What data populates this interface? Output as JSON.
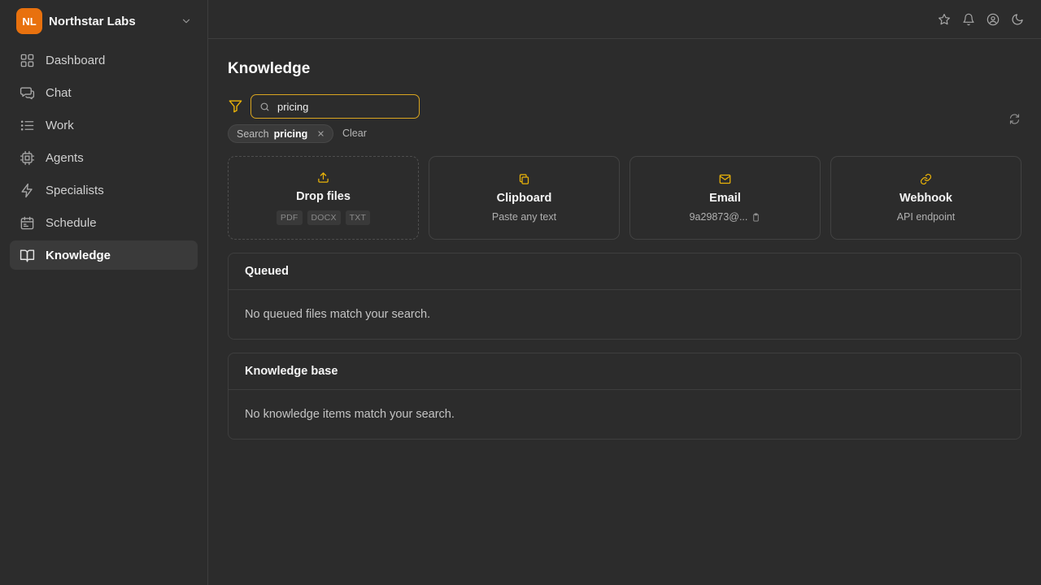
{
  "org": {
    "initials": "NL",
    "name": "Northstar Labs"
  },
  "sidebar": {
    "items": [
      {
        "label": "Dashboard",
        "icon": "dashboard-icon"
      },
      {
        "label": "Chat",
        "icon": "chat-icon"
      },
      {
        "label": "Work",
        "icon": "list-icon"
      },
      {
        "label": "Agents",
        "icon": "cpu-icon"
      },
      {
        "label": "Specialists",
        "icon": "bolt-icon"
      },
      {
        "label": "Schedule",
        "icon": "calendar-icon"
      },
      {
        "label": "Knowledge",
        "icon": "book-icon",
        "active": true
      }
    ]
  },
  "topbar": {
    "icons": [
      "star-icon",
      "bell-icon",
      "user-icon",
      "moon-icon"
    ]
  },
  "page": {
    "title": "Knowledge"
  },
  "search": {
    "value": "pricing",
    "placeholder": ""
  },
  "chip": {
    "label": "Search",
    "value": "pricing"
  },
  "clear_label": "Clear",
  "sources": {
    "drop": {
      "title": "Drop files",
      "tags": [
        "PDF",
        "DOCX",
        "TXT"
      ]
    },
    "clipboard": {
      "title": "Clipboard",
      "subtitle": "Paste any text"
    },
    "email": {
      "title": "Email",
      "subtitle": "9a29873@..."
    },
    "webhook": {
      "title": "Webhook",
      "subtitle": "API endpoint"
    }
  },
  "queued": {
    "title": "Queued",
    "empty": "No queued files match your search."
  },
  "knowledge_base": {
    "title": "Knowledge base",
    "empty": "No knowledge items match your search."
  },
  "colors": {
    "accent": "#eab308",
    "brand": "#e8710e",
    "background": "#2c2c2c"
  }
}
